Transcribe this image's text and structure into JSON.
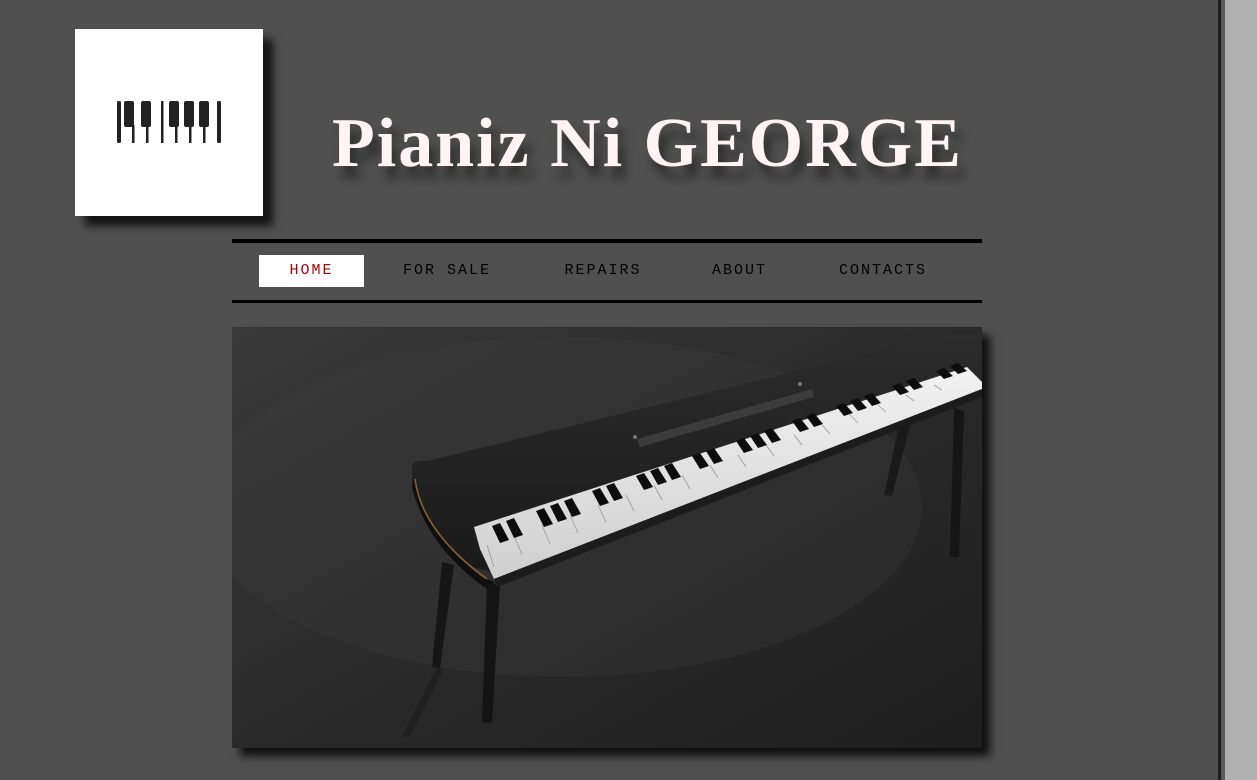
{
  "site": {
    "title": "Pianiz Ni GEORGE",
    "logo_icon": "piano-keys-icon",
    "hero_image": "digital-piano-on-stand"
  },
  "nav": {
    "items": [
      {
        "label": "HOME",
        "active": true
      },
      {
        "label": "FOR SALE",
        "active": false
      },
      {
        "label": "REPAIRS",
        "active": false
      },
      {
        "label": "ABOUT",
        "active": false
      },
      {
        "label": "CONTACTS",
        "active": false
      }
    ]
  },
  "colors": {
    "background": "#505050",
    "nav_active_text": "#b00000",
    "title_text": "#fff4f4"
  }
}
